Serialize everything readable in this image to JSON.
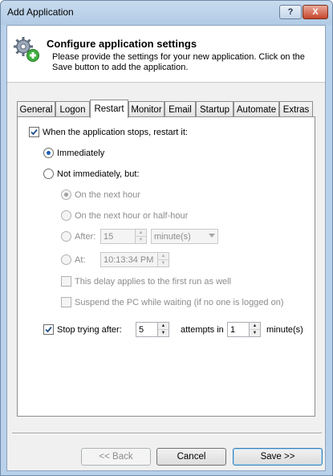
{
  "window": {
    "title": "Add Application",
    "help_label": "?",
    "close_label": "X"
  },
  "header": {
    "title": "Configure application settings",
    "subtitle": "Please provide the settings for your new application. Click on the Save button to add the application.",
    "icon": "gear-plus-icon"
  },
  "tabs": [
    {
      "label": "General"
    },
    {
      "label": "Logon"
    },
    {
      "label": "Restart",
      "active": true
    },
    {
      "label": "Monitor"
    },
    {
      "label": "Email"
    },
    {
      "label": "Startup"
    },
    {
      "label": "Automate"
    },
    {
      "label": "Extras"
    }
  ],
  "restart": {
    "restart_checkbox": {
      "label": "When the application stops, restart it:",
      "checked": true
    },
    "immediately": {
      "label": "Immediately",
      "selected": true
    },
    "not_immediately": {
      "label": "Not immediately, but:",
      "selected": false
    },
    "next_hour": {
      "label": "On the next hour",
      "selected": true,
      "enabled": false
    },
    "next_half_hour": {
      "label": "On the next hour or half-hour",
      "enabled": false
    },
    "after": {
      "label": "After:",
      "value": "15",
      "unit": "minute(s)",
      "enabled": false
    },
    "at": {
      "label": "At:",
      "value": "10:13:34 PM",
      "enabled": false
    },
    "first_run": {
      "label": "This delay applies to the first run as well",
      "checked": false
    },
    "suspend": {
      "label": "Suspend the PC while waiting (if no one is logged on)",
      "checked": false
    },
    "stop_trying": {
      "label": "Stop trying after:",
      "checked": true,
      "attempts_value": "5",
      "attempts_label": "attempts in",
      "minutes_value": "1",
      "minutes_label": "minute(s)"
    }
  },
  "buttons": {
    "back": "<< Back",
    "cancel": "Cancel",
    "save": "Save >>"
  }
}
